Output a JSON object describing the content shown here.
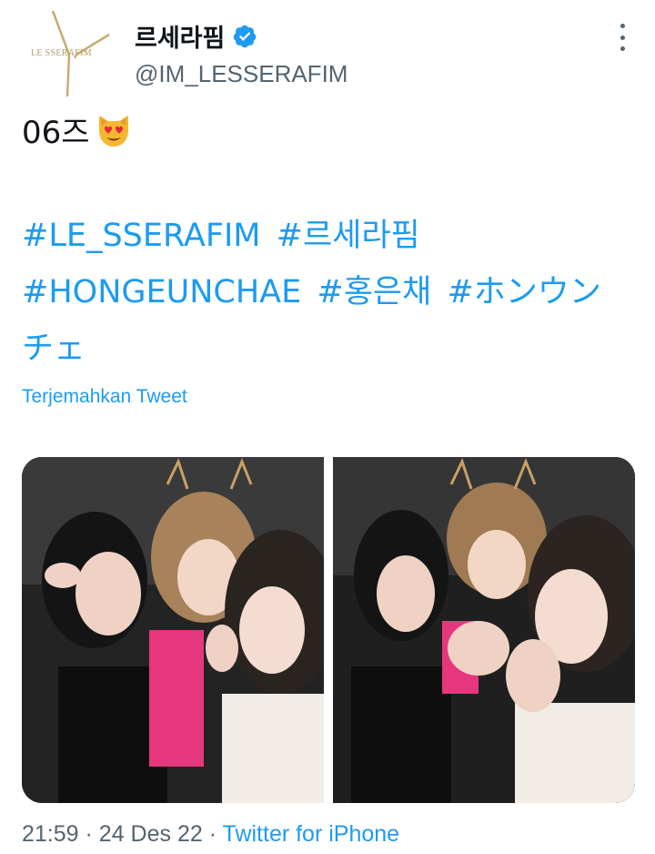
{
  "header": {
    "display_name": "르세라핌",
    "handle": "@IM_LESSERAFIM",
    "logo_text": "LE SSERAFIM",
    "verified_icon": "verified-badge-icon",
    "more_icon": "more-vertical-icon"
  },
  "tweet": {
    "text_line": "06즈",
    "emoji": "smiling-cat-heart-eyes-emoji",
    "hashtags": [
      "#LE_SSERAFIM",
      "#르세라핌",
      "#HONGEUNCHAE",
      "#홍은채",
      "#ホンウンチェ"
    ],
    "translate_label": "Terjemahkan Tweet"
  },
  "media": {
    "photos": [
      "photo-1",
      "photo-2"
    ]
  },
  "footer": {
    "time": "21:59",
    "date": "24 Des 22",
    "source": "Twitter for iPhone",
    "separator": "·"
  },
  "colors": {
    "link": "#1d9bf0",
    "secondary": "#536471",
    "primary": "#0f1419",
    "logo_gold": "#b69a62"
  }
}
